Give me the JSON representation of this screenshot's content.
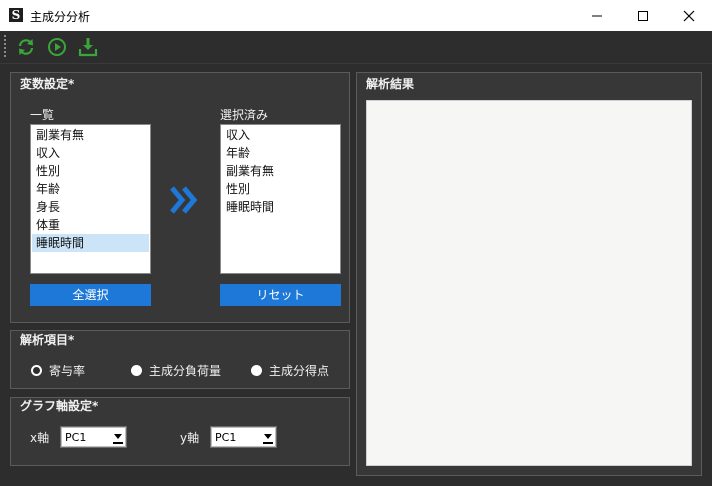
{
  "window": {
    "app_icon_letter": "S",
    "title": "主成分分析"
  },
  "toolbar": {
    "icons": [
      "refresh-icon",
      "play-icon",
      "download-icon"
    ],
    "icon_color": "#3aa53a"
  },
  "variable_settings": {
    "title": "変数設定*",
    "available_label": "一覧",
    "available_items": [
      "副業有無",
      "収入",
      "性別",
      "年齢",
      "身長",
      "体重",
      "睡眠時間"
    ],
    "highlighted_item": "睡眠時間",
    "selected_label": "選択済み",
    "selected_items": [
      "収入",
      "年齢",
      "副業有無",
      "性別",
      "睡眠時間"
    ],
    "select_all_button": "全選択",
    "reset_button": "リセット",
    "move_icon": "double-chevron-right-icon"
  },
  "analysis_items": {
    "title": "解析項目*",
    "options": [
      "寄与率",
      "主成分負荷量",
      "主成分得点"
    ],
    "selected_option": "寄与率"
  },
  "graph_axis": {
    "title": "グラフ軸設定*",
    "x_label": "x軸",
    "x_value": "PC1",
    "y_label": "y軸",
    "y_value": "PC1"
  },
  "results": {
    "title": "解析結果"
  },
  "colors": {
    "background": "#2d2d2d",
    "panel": "#373737",
    "accent_blue": "#1e78d8",
    "highlight": "#cce4f7",
    "results_area": "#f6f6f4"
  }
}
